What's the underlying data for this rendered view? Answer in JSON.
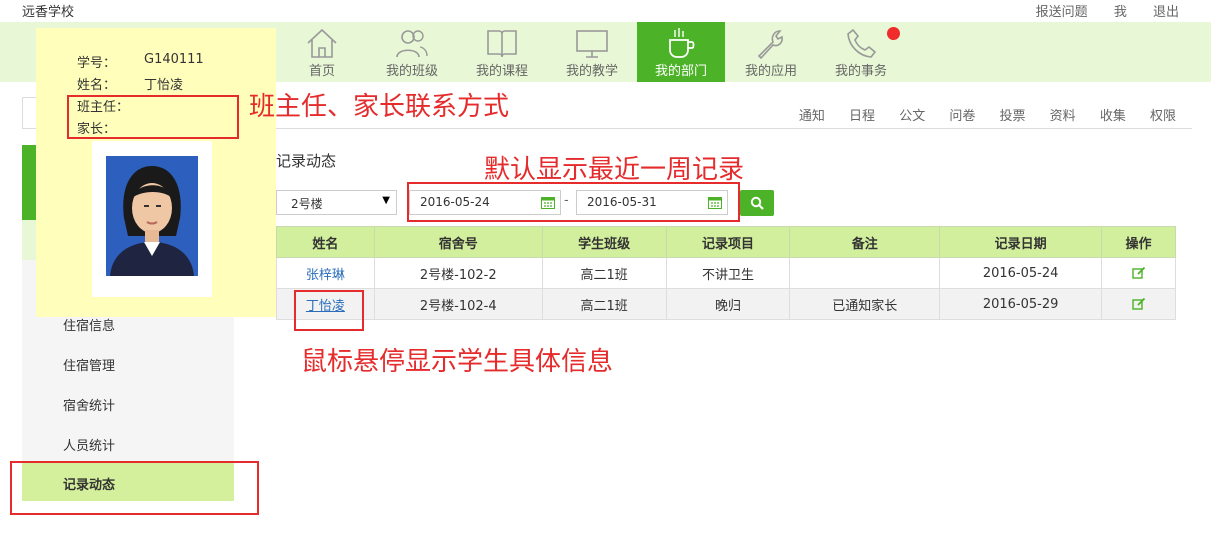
{
  "top": {
    "school": "远香学校",
    "links": [
      "报送问题",
      "我",
      "退出"
    ]
  },
  "nav": {
    "items": [
      {
        "label": "首页",
        "icon": "home-icon"
      },
      {
        "label": "我的班级",
        "icon": "people-icon"
      },
      {
        "label": "我的课程",
        "icon": "book-icon"
      },
      {
        "label": "我的教学",
        "icon": "monitor-icon"
      },
      {
        "label": "我的部门",
        "icon": "cup-icon"
      },
      {
        "label": "我的应用",
        "icon": "wrench-icon"
      },
      {
        "label": "我的事务",
        "icon": "phone-icon"
      }
    ],
    "active": "我的部门",
    "accent": "#4cb227",
    "bar_bg": "#e8f7d5",
    "badge_color": "#ef2b2b"
  },
  "subtabs": [
    "通知",
    "日程",
    "公文",
    "问卷",
    "投票",
    "资料",
    "收集",
    "权限"
  ],
  "sidebar": {
    "items": [
      "住宿信息",
      "住宿管理",
      "宿舍统计",
      "人员统计",
      "记录动态"
    ],
    "active": "记录动态"
  },
  "content": {
    "title": "记录动态",
    "building": "2号楼",
    "date_from": "2016-05-24",
    "date_to": "2016-05-31",
    "date_sep": "-",
    "columns": [
      "姓名",
      "宿舍号",
      "学生班级",
      "记录项目",
      "备注",
      "记录日期",
      "操作"
    ],
    "rows": [
      {
        "name": "张梓琳",
        "dorm": "2号楼-102-2",
        "class": "高二1班",
        "item": "不讲卫生",
        "note": "",
        "date": "2016-05-24"
      },
      {
        "name": "丁怡凌",
        "dorm": "2号楼-102-4",
        "class": "高二1班",
        "item": "晚归",
        "note": "已通知家长",
        "date": "2016-05-29"
      }
    ]
  },
  "tooltip": {
    "student_no_label": "学号：",
    "student_no": "G140111",
    "name_label": "姓名：",
    "name": "丁怡凌",
    "teacher_label": "班主任：",
    "parent_label": "家长："
  },
  "annotations": {
    "contact": "班主任、家长联系方式",
    "week": "默认显示最近一周记录",
    "hover": "鼠标悬停显示学生具体信息",
    "color": "#e52b2b"
  }
}
